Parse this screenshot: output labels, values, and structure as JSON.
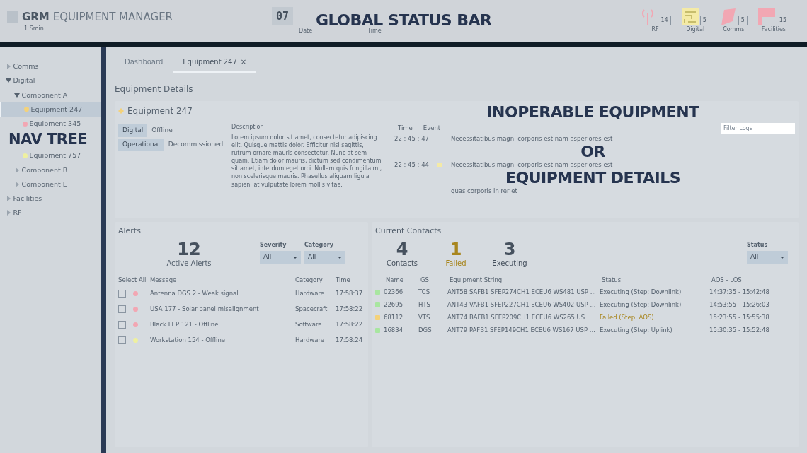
{
  "header": {
    "logo_bold": "GRM",
    "logo_text": "EQUIPMENT MANAGER",
    "subtitle": "1 Smin",
    "clock": "07",
    "date_label": "Date",
    "time_label": "Time",
    "status_icons": [
      {
        "label": "RF",
        "count": "14",
        "kind": "antenna",
        "color": "#f2a7b3"
      },
      {
        "label": "Digital",
        "count": "5",
        "kind": "maze",
        "color": "#f4eaa6"
      },
      {
        "label": "Comms",
        "count": "5",
        "kind": "dish",
        "color": "#f2a7b3"
      },
      {
        "label": "Facilities",
        "count": "15",
        "kind": "flag",
        "color": "#f2a7b3"
      }
    ]
  },
  "nav_tree": [
    {
      "label": "Comms",
      "expanded": false,
      "selected": false
    },
    {
      "label": "Digital",
      "expanded": true,
      "selected": false,
      "children": [
        {
          "label": "Component A",
          "expanded": true,
          "selected": false,
          "children": [
            {
              "label": "Equipment 247",
              "color": "#f4d27a",
              "selected": true
            },
            {
              "label": "Equipment 345",
              "color": "#f2a7b3",
              "selected": false
            },
            {
              "label": "Equipment 757",
              "color": "#eef0a0",
              "selected": false
            }
          ]
        },
        {
          "label": "Component B",
          "expanded": false,
          "selected": false
        },
        {
          "label": "Component E",
          "expanded": false,
          "selected": false
        }
      ]
    },
    {
      "label": "Facilities",
      "expanded": false,
      "selected": false
    },
    {
      "label": "RF",
      "expanded": false,
      "selected": false
    }
  ],
  "tabs": [
    {
      "label": "Dashboard",
      "selected": false
    },
    {
      "label": "Equipment 247",
      "selected": true,
      "close": "×"
    }
  ],
  "details": {
    "title": "Equipment Details",
    "name": "Equipment 247",
    "color": "#f4d27a",
    "badges": [
      [
        "Digital",
        "Offline"
      ],
      [
        "Operational",
        "Decommissioned"
      ]
    ],
    "description_label": "Description",
    "description": "Lorem ipsum dolor sit amet, consectetur adipiscing elit. Quisque mattis dolor. Efficitur nisl sagittis, rutrum ornare mauris consectetur. Nunc at sem quam. Etiam dolor mauris, dictum sed condimentum sit amet, interdum eget orci. Nullam quis fringilla mi, non scelerisque mauris. Phasellus aliquam ligula sapien, at vulputate lorem mollis vitae.",
    "log_columns": [
      "Time",
      "Event"
    ],
    "log_rows": [
      {
        "time": "22 : 45 : 47",
        "event": "Necessitatibus magni corporis est nam asperiores est"
      },
      {
        "time": "22 : 45 : 44",
        "event": "Necessitatibus magni corporis est nam asperiores est",
        "color": "#f4eaa6"
      },
      {
        "event": "quas corporis in rer et"
      }
    ],
    "filter_placeholder": "Filter Logs"
  },
  "overlay_labels": {
    "status": "GLOBAL STATUS BAR",
    "nav": "NAV TREE",
    "main": [
      "INOPERABLE EQUIPMENT",
      "OR",
      "EQUIPMENT DETAILS"
    ]
  },
  "alerts": {
    "title": "Alerts",
    "count": "12",
    "count_label": "Active Alerts",
    "filters": [
      {
        "label": "Severity",
        "value": "All"
      },
      {
        "label": "Category",
        "value": "All"
      }
    ],
    "columns": [
      "Select All",
      "Message",
      "Category",
      "Time"
    ],
    "rows": [
      {
        "checked": false,
        "color": "#f2a7b3",
        "message": "Antenna DGS 2 - Weak signal",
        "category": "Hardware",
        "time": "17:58:37"
      },
      {
        "checked": false,
        "color": "#f2a7b3",
        "message": "USA 177 - Solar panel misalignment",
        "category": "Spacecraft",
        "time": "17:58:22"
      },
      {
        "checked": false,
        "color": "#f2a7b3",
        "message": "Black FEP 121 - Offline",
        "category": "Software",
        "time": "17:58:22"
      },
      {
        "checked": false,
        "color": "#eef0a0",
        "message": "Workstation 154 - Offline",
        "category": "Hardware",
        "time": "17:58:24"
      }
    ]
  },
  "contacts": {
    "title": "Current Contacts",
    "stats": [
      {
        "value": "4",
        "label": "Contacts",
        "kind": "total"
      },
      {
        "value": "1",
        "label": "Failed",
        "kind": "failed"
      },
      {
        "value": "3",
        "label": "Executing",
        "kind": "executing"
      }
    ],
    "filter": {
      "label": "Status",
      "value": "All"
    },
    "columns": [
      "Name",
      "GS",
      "Equipment String",
      "Status",
      "AOS - LOS"
    ],
    "rows": [
      {
        "color": "#a8e6a0",
        "name": "02366",
        "gs": "TCS",
        "equipment": "ANT58 SAFB1 SFEP274CH1 ECEU6 WS481 USP ...",
        "status": "Executing (Step: Downlink)",
        "failed": false,
        "window": "14:37:35 - 15:42:48"
      },
      {
        "color": "#a8e6a0",
        "name": "22695",
        "gs": "HTS",
        "equipment": "ANT43 VAFB1 SFEP227CH1 ECEU6 WS402 USP ...",
        "status": "Executing (Step: Downlink)",
        "failed": false,
        "window": "14:53:55 - 15:26:03"
      },
      {
        "color": "#f4d27a",
        "name": "68112",
        "gs": "VTS",
        "equipment": "ANT74 BAFB1 SFEP209CH1 ECEU6 WS265 US...",
        "status": "Failed (Step: AOS)",
        "failed": true,
        "window": "15:23:55 - 15:55:38"
      },
      {
        "color": "#a8e6a0",
        "name": "16834",
        "gs": "DGS",
        "equipment": "ANT79 PAFB1 SFEP149CH1 ECEU6 WS167 USP ...",
        "status": "Executing (Step: Uplink)",
        "failed": false,
        "window": "15:30:35 - 15:52:48"
      }
    ]
  }
}
